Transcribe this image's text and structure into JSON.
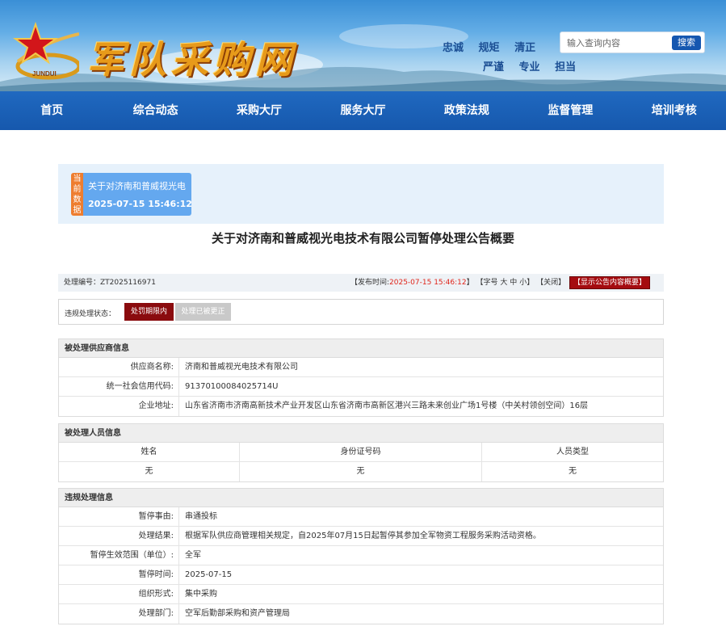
{
  "header": {
    "logo_text": "军队采购网",
    "emblem_text": "JUNDUI",
    "slogans_row1": [
      "忠诚",
      "规矩",
      "清正"
    ],
    "slogans_row2": [
      "严谨",
      "专业",
      "担当"
    ],
    "search_placeholder": "输入查询内容",
    "search_button": "搜索"
  },
  "nav": [
    "首页",
    "综合动态",
    "采购大厅",
    "服务大厅",
    "政策法规",
    "监督管理",
    "培训考核"
  ],
  "notice": {
    "tag": "当前数据",
    "title": "关于对济南和普威视光电",
    "datetime": "2025-07-15 15:46:12"
  },
  "page_title": "关于对济南和普威视光电技术有限公司暂停处理公告概要",
  "meta": {
    "code_label": "处理编号：",
    "code": "ZT2025116971",
    "publish_label": "【发布时间:",
    "publish_time": "2025-07-15 15:46:12",
    "publish_end": "】",
    "font_label": "【字号",
    "font_large": "大",
    "font_medium": "中",
    "font_small": "小",
    "font_end": "】",
    "close": "【关闭】",
    "show_summary": "【显示公告内容概要】"
  },
  "status": {
    "label": "违规处理状态：",
    "state1": "处罚期限内",
    "state2": "处理已被更正"
  },
  "supplier": {
    "title": "被处理供应商信息",
    "rows": [
      {
        "k": "供应商名称:",
        "v": "济南和普威视光电技术有限公司"
      },
      {
        "k": "统一社会信用代码:",
        "v": "91370100084025714U"
      },
      {
        "k": "企业地址:",
        "v": "山东省济南市济南高新技术产业开发区山东省济南市高新区港兴三路未来创业广场1号楼（中关村领创空间）16层"
      }
    ]
  },
  "persons": {
    "title": "被处理人员信息",
    "headers": [
      "姓名",
      "身份证号码",
      "人员类型"
    ],
    "row": [
      "无",
      "无",
      "无"
    ]
  },
  "violation": {
    "title": "违规处理信息",
    "rows": [
      {
        "k": "暂停事由:",
        "v": "串通投标"
      },
      {
        "k": "处理结果:",
        "v": "根据军队供应商管理相关规定，自2025年07月15日起暂停其参加全军物资工程服务采购活动资格。"
      },
      {
        "k": "暂停生效范围（单位）:",
        "v": "全军"
      },
      {
        "k": "暂停时间:",
        "v": "2025-07-15"
      },
      {
        "k": "组织形式:",
        "v": "集中采购"
      },
      {
        "k": "处理部门:",
        "v": "空军后勤部采购和资产管理局"
      }
    ]
  }
}
